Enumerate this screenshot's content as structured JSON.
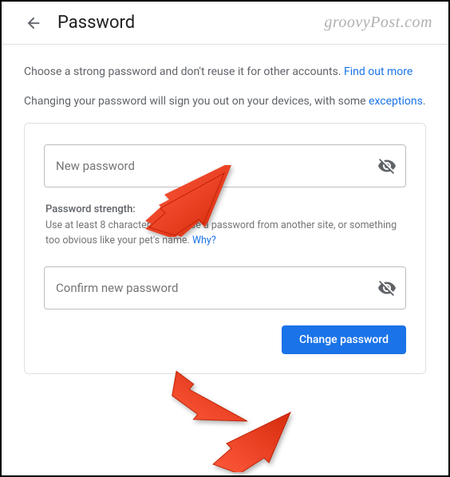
{
  "header": {
    "title": "Password"
  },
  "watermark": "groovyPost.com",
  "intro": {
    "text1": "Choose a strong password and don't reuse it for other accounts. ",
    "link1": "Find out more",
    "text2": "Changing your password will sign you out on your devices, with some ",
    "link2": "exceptions",
    "period": "."
  },
  "form": {
    "new_password_placeholder": "New password",
    "confirm_password_placeholder": "Confirm new password",
    "strength_label": "Password strength:",
    "strength_hint": "Use at least 8 characters. Don't use a password from another site, or something too obvious like your pet's name. ",
    "why_link": "Why?",
    "submit_label": "Change password"
  }
}
